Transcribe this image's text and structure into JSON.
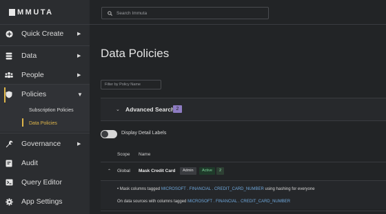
{
  "app": {
    "logo_text": "MMUTA"
  },
  "search": {
    "placeholder": "Search Immuta"
  },
  "sidebar": {
    "items": [
      {
        "label": "Quick Create",
        "icon": "plus-circle-icon",
        "has_chevron": true
      },
      {
        "label": "Data",
        "icon": "database-icon",
        "has_chevron": true
      },
      {
        "label": "People",
        "icon": "people-icon",
        "has_chevron": true
      },
      {
        "label": "Policies",
        "icon": "shield-icon",
        "expanded": true
      },
      {
        "label": "Governance",
        "icon": "wrench-icon",
        "has_chevron": true
      },
      {
        "label": "Audit",
        "icon": "audit-icon"
      },
      {
        "label": "Query Editor",
        "icon": "terminal-icon"
      },
      {
        "label": "App Settings",
        "icon": "gear-icon"
      }
    ],
    "policies_sub": [
      "Subscription Policies",
      "Data Policies"
    ]
  },
  "main": {
    "title": "Data Policies",
    "filter_placeholder": "Filter by Policy Name",
    "advanced_search": {
      "label": "Advanced Search",
      "count": "2"
    },
    "toggle_label": "Display Detail Labels",
    "columns": [
      "Scope",
      "Name"
    ],
    "row": {
      "scope": "Global",
      "name": "Mask Credit Card",
      "badge_admin": "Admin",
      "badge_active": "Active",
      "badge_count": "2"
    },
    "detail": {
      "line1_prefix": "Mask columns tagged",
      "line1_tag": "MICROSOFT . FINANCIAL . CREDIT_CARD_NUMBER",
      "line1_suffix": "using hashing for everyone",
      "line2_prefix": "On data sources with columns tagged",
      "line2_tag": "MICROSOFT . FINANCIAL . CREDIT_CARD_NUMBER"
    }
  },
  "colors": {
    "accent": "#e0b74a",
    "tag": "#6fa8dc",
    "count_badge": "#8e7cc3",
    "active_badge": "#7fd39b"
  }
}
